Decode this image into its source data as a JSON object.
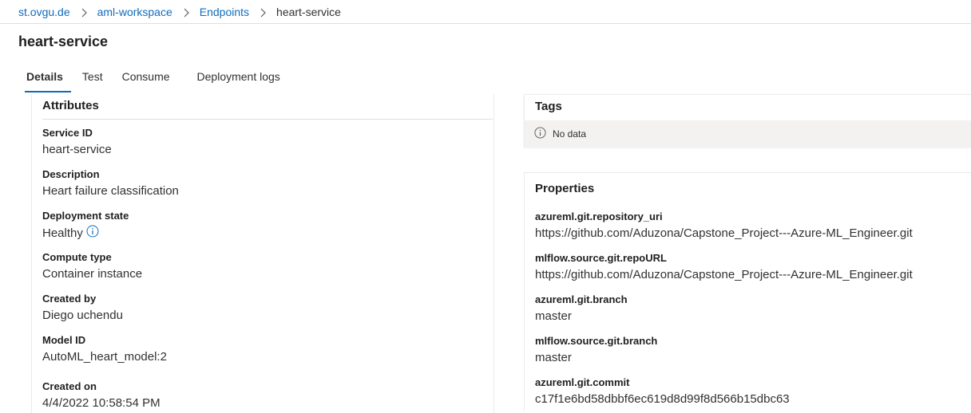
{
  "breadcrumb": {
    "items": [
      "st.ovgu.de",
      "aml-workspace",
      "Endpoints",
      "heart-service"
    ]
  },
  "page": {
    "title": "heart-service"
  },
  "tabs": [
    "Details",
    "Test",
    "Consume",
    "Deployment logs"
  ],
  "attributes": {
    "title": "Attributes",
    "fields": [
      {
        "label": "Service ID",
        "value": "heart-service"
      },
      {
        "label": "Description",
        "value": "Heart failure classification"
      },
      {
        "label": "Deployment state",
        "value": "Healthy"
      },
      {
        "label": "Compute type",
        "value": "Container instance"
      },
      {
        "label": "Created by",
        "value": "Diego uchendu"
      },
      {
        "label": "Model ID",
        "value": "AutoML_heart_model:2"
      },
      {
        "label": "Created on",
        "value": "4/4/2022 10:58:54 PM"
      }
    ]
  },
  "tags": {
    "title": "Tags",
    "empty_text": "No data"
  },
  "properties": {
    "title": "Properties",
    "items": [
      {
        "label": "azureml.git.repository_uri",
        "value": "https://github.com/Aduzona/Capstone_Project---Azure-ML_Engineer.git"
      },
      {
        "label": "mlflow.source.git.repoURL",
        "value": "https://github.com/Aduzona/Capstone_Project---Azure-ML_Engineer.git"
      },
      {
        "label": "azureml.git.branch",
        "value": "master"
      },
      {
        "label": "mlflow.source.git.branch",
        "value": "master"
      },
      {
        "label": "azureml.git.commit",
        "value": "c17f1e6bd58dbbf6ec619d8d99f8d566b15dbc63"
      }
    ]
  },
  "colors": {
    "link": "#0f6cbd",
    "active_tab_underline": "#0f6cbd",
    "empty_bg": "#f3f2f1"
  },
  "icons": {
    "info": "info-icon",
    "chevron": "chevron-right-icon"
  }
}
